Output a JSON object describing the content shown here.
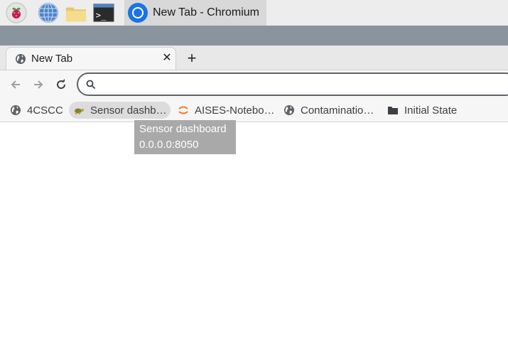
{
  "taskbar": {
    "icons": [
      "raspberry-pi-menu-icon",
      "web-browser-icon",
      "file-manager-icon",
      "terminal-icon"
    ],
    "active_task": {
      "label": "New Tab - Chromium",
      "icon": "chromium-icon"
    }
  },
  "browser": {
    "tabs": [
      {
        "label": "New Tab",
        "icon": "globe-icon",
        "close_glyph": "✕"
      }
    ],
    "new_tab_glyph": "+",
    "omnibox": {
      "value": "",
      "placeholder": ""
    },
    "bookmarks": [
      {
        "label": "4CSCC",
        "icon": "globe-icon"
      },
      {
        "label": "Sensor dashb…",
        "icon": "turtle-icon"
      },
      {
        "label": "AISES-Notebo…",
        "icon": "jupyter-icon"
      },
      {
        "label": "Contaminatio…",
        "icon": "globe-icon"
      },
      {
        "label": "Initial State",
        "icon": "folder-icon"
      }
    ],
    "tooltip": {
      "title": "Sensor dashboard",
      "url": "0.0.0.0:8050"
    }
  },
  "colors": {
    "taskbar": "#ededed",
    "title_strip": "#8a949c",
    "tooltip_bg": "#a9a9a9",
    "jupyter_orange": "#f37726"
  }
}
